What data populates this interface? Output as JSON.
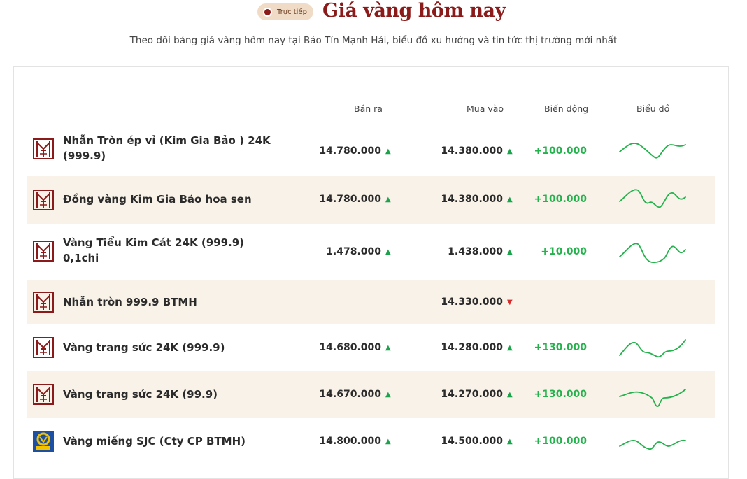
{
  "header": {
    "live_label": "Trực tiếp",
    "title": "Giá vàng hôm nay",
    "subtitle": "Theo dõi bảng giá vàng hôm nay tại Bảo Tín Mạnh Hải, biểu đồ xu hướng và tin tức thị trường mới nhất"
  },
  "table": {
    "columns": {
      "sell": "Bán ra",
      "buy": "Mua vào",
      "change": "Biến động",
      "chart": "Biểu đồ"
    },
    "rows": [
      {
        "name": "Nhẫn Tròn ép vỉ (Kim Gia Bảo ) 24K (999.9)",
        "sell": "14.780.000",
        "sell_trend": "up",
        "buy": "14.380.000",
        "buy_trend": "up",
        "change": "+100.000",
        "logo": "btmh-logo",
        "has_chart": true
      },
      {
        "name": "Đồng vàng Kim Gia Bảo hoa sen",
        "sell": "14.780.000",
        "sell_trend": "up",
        "buy": "14.380.000",
        "buy_trend": "up",
        "change": "+100.000",
        "logo": "btmh-logo",
        "has_chart": true
      },
      {
        "name": "Vàng Tiểu Kim Cát 24K (999.9) 0,1chi",
        "sell": "1.478.000",
        "sell_trend": "up",
        "buy": "1.438.000",
        "buy_trend": "up",
        "change": "+10.000",
        "logo": "btmh-logo",
        "has_chart": true
      },
      {
        "name": "Nhẫn tròn 999.9 BTMH",
        "sell": "",
        "sell_trend": "",
        "buy": "14.330.000",
        "buy_trend": "down",
        "change": "",
        "logo": "btmh-logo",
        "has_chart": false
      },
      {
        "name": "Vàng trang sức 24K (999.9)",
        "sell": "14.680.000",
        "sell_trend": "up",
        "buy": "14.280.000",
        "buy_trend": "up",
        "change": "+130.000",
        "logo": "btmh-logo",
        "has_chart": true
      },
      {
        "name": "Vàng trang sức 24K (99.9)",
        "sell": "14.670.000",
        "sell_trend": "up",
        "buy": "14.270.000",
        "buy_trend": "up",
        "change": "+130.000",
        "logo": "btmh-logo",
        "has_chart": true
      },
      {
        "name": "Vàng miếng SJC (Cty CP BTMH)",
        "sell": "14.800.000",
        "sell_trend": "up",
        "buy": "14.500.000",
        "buy_trend": "up",
        "change": "+100.000",
        "logo": "sjc-logo",
        "has_chart": true
      }
    ]
  },
  "colors": {
    "brand": "#8b1a1a",
    "up": "#1aa34a",
    "down": "#d62b2b",
    "change": "#23b24c",
    "alt_row": "#f8f2e9",
    "badge": "#f0dcc6"
  }
}
